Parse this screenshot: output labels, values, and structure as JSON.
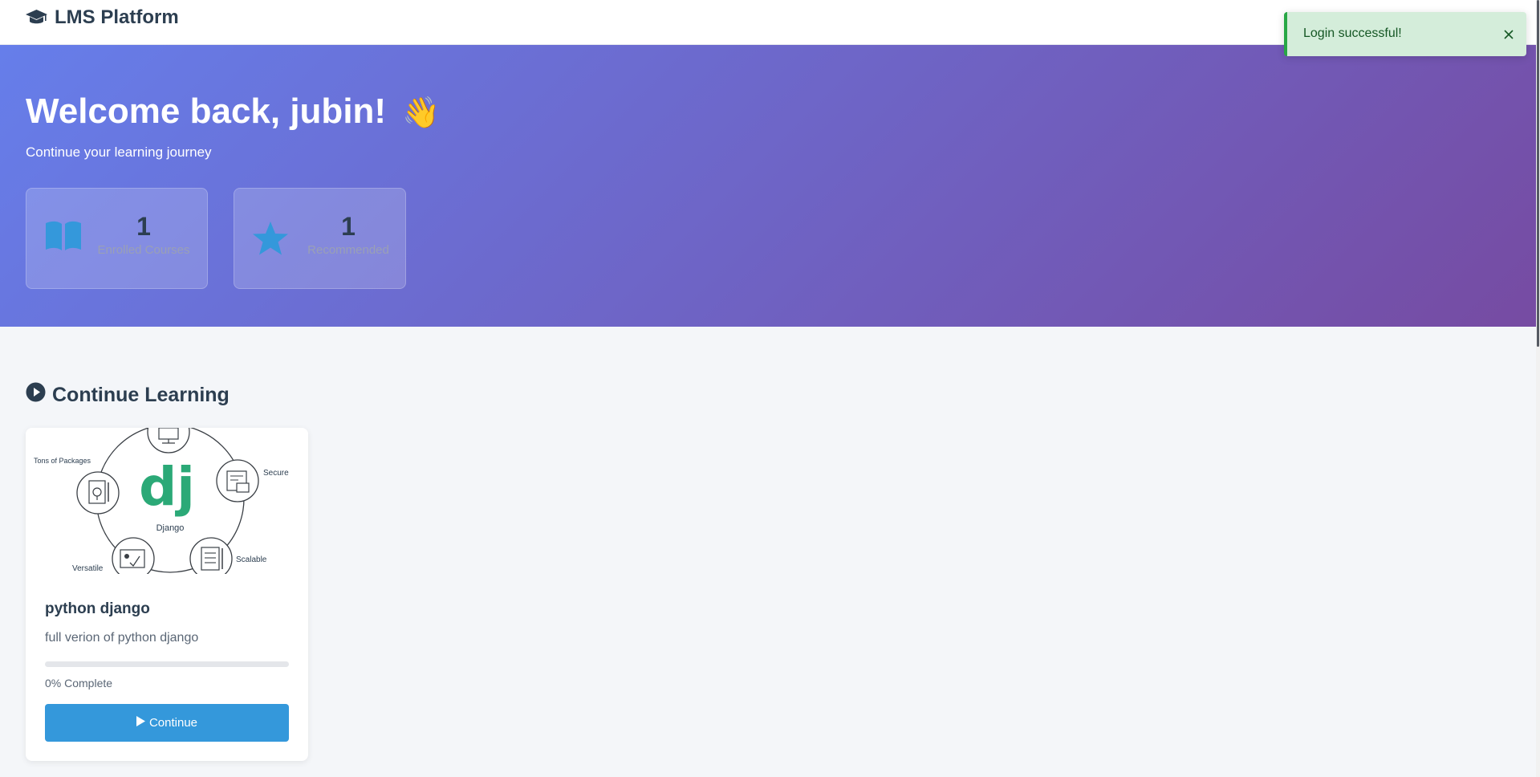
{
  "navbar": {
    "brand": "LMS Platform",
    "brand_icon": "graduation-cap-icon"
  },
  "hero": {
    "title": "Welcome back, jubin!",
    "emoji": "👋",
    "subtitle": "Continue your learning journey",
    "stats": [
      {
        "icon": "book-icon",
        "value": "1",
        "label": "Enrolled Courses"
      },
      {
        "icon": "star-icon",
        "value": "1",
        "label": "Recommended"
      }
    ]
  },
  "section": {
    "title": "Continue Learning",
    "icon": "play-circle-icon"
  },
  "course": {
    "image": {
      "logo": "dj",
      "center_label": "Django",
      "features": [
        "Tons of Packages",
        "Secure",
        "Versatile",
        "Scalable"
      ]
    },
    "title": "python django",
    "description": "full verion of python django",
    "progress": 0,
    "progress_label": "0% Complete",
    "button_label": "Continue"
  },
  "toast": {
    "message": "Login successful!"
  },
  "colors": {
    "hero_gradient_start": "#667eea",
    "hero_gradient_end": "#764ba2",
    "accent": "#3498db",
    "toast_bg": "#d4edda",
    "toast_border": "#28a745",
    "django_green": "#2ba977"
  }
}
